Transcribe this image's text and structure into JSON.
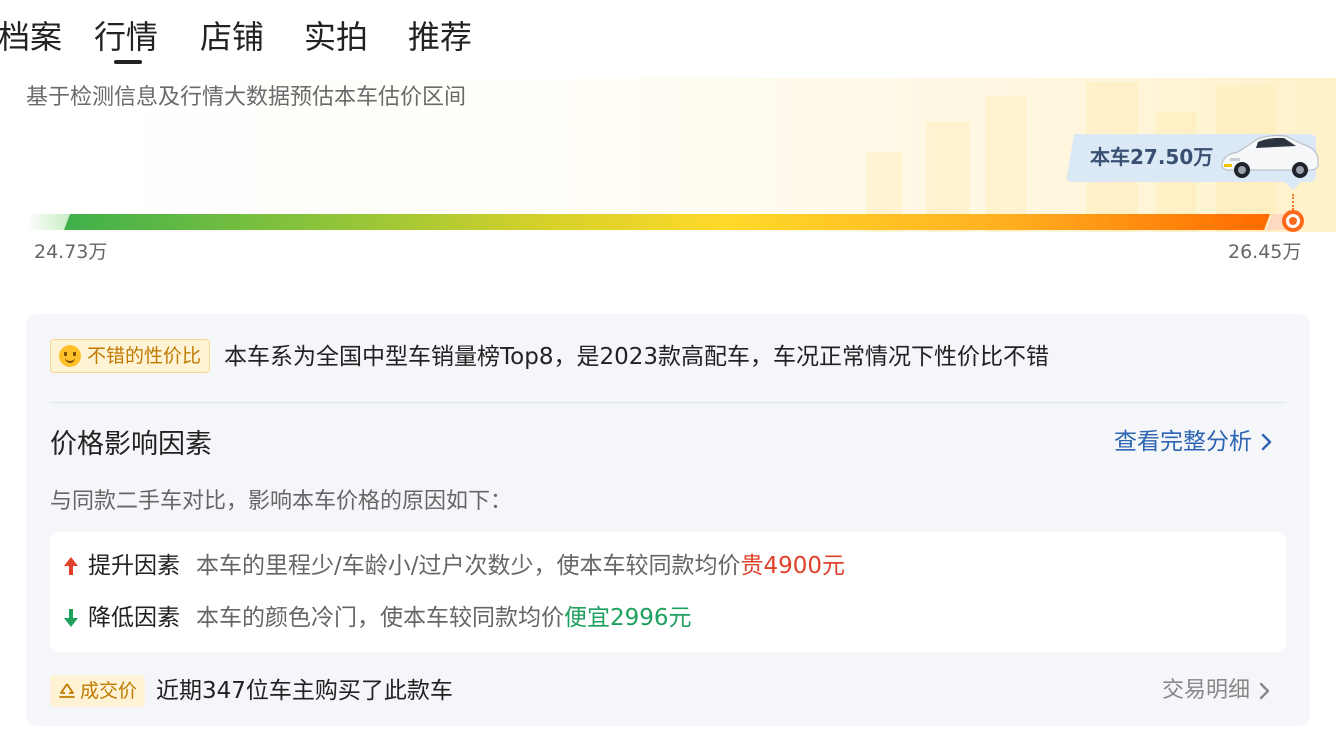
{
  "tabs": [
    {
      "label": "档案"
    },
    {
      "label": "行情",
      "active": true
    },
    {
      "label": "店铺"
    },
    {
      "label": "实拍"
    },
    {
      "label": "推荐"
    }
  ],
  "price_range": {
    "subtitle": "基于检测信息及行情大数据预估本车估价区间",
    "car_price_label": "本车27.50万",
    "min_label": "24.73万",
    "max_label": "26.45万"
  },
  "analysis": {
    "value_badge": "不错的性价比",
    "summary": "本车系为全国中型车销量榜Top8，是2023款高配车，车况正常情况下性价比不错",
    "factors_title": "价格影响因素",
    "full_analysis_link": "查看完整分析",
    "factors_desc": "与同款二手车对比，影响本车价格的原因如下：",
    "factors": [
      {
        "label": "提升因素",
        "desc": "本车的里程少/车龄小/过户次数少，使本车较同款均价",
        "value": "贵4900元",
        "direction": "up",
        "color": "#e0412b"
      },
      {
        "label": "降低因素",
        "desc": "本车的颜色冷门，使本车较同款均价",
        "value": "便宜2996元",
        "direction": "down",
        "color": "#1ea05e"
      }
    ],
    "deal_badge": "成交价",
    "deal_text": "近期347位车主购买了此款车",
    "deal_link": "交易明细"
  },
  "colors": {
    "accent_link": "#2d64b3",
    "badge_bg": "#fff3d6",
    "badge_text": "#c07a00",
    "marker": "#ff6a1a"
  }
}
